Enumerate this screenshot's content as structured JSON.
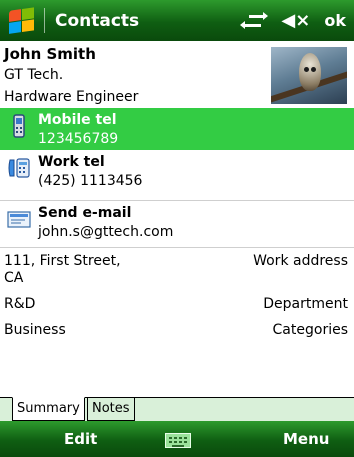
{
  "titlebar": {
    "title": "Contacts",
    "ok_label": "ok",
    "icons": [
      "start-menu-icon",
      "connectivity-icon",
      "volume-muted-icon"
    ]
  },
  "contact": {
    "name": "John Smith",
    "company": "GT Tech.",
    "job_title": "Hardware Engineer"
  },
  "actions": [
    {
      "label": "Mobile tel",
      "value": "123456789",
      "icon": "mobile-phone-icon",
      "selected": true
    },
    {
      "label": "Work tel",
      "value": "(425) 1113456",
      "icon": "work-phone-icon",
      "selected": false
    },
    {
      "label": "Send e-mail",
      "value": "john.s@gttech.com",
      "icon": "email-icon",
      "selected": false
    }
  ],
  "details": [
    {
      "value_line1": "111, First Street,",
      "value_line2": "CA",
      "key": "Work address"
    },
    {
      "value": "R&D",
      "key": "Department"
    },
    {
      "value": "Business",
      "key": "Categories"
    }
  ],
  "tabs": [
    {
      "label": "Summary",
      "active": true
    },
    {
      "label": "Notes",
      "active": false
    }
  ],
  "softkeys": {
    "left": "Edit",
    "right": "Menu",
    "center_icon": "keyboard-icon"
  },
  "colors": {
    "title_bar": "#0f5e12",
    "selection": "#33cc44",
    "tab_strip": "#d9f0d9"
  }
}
